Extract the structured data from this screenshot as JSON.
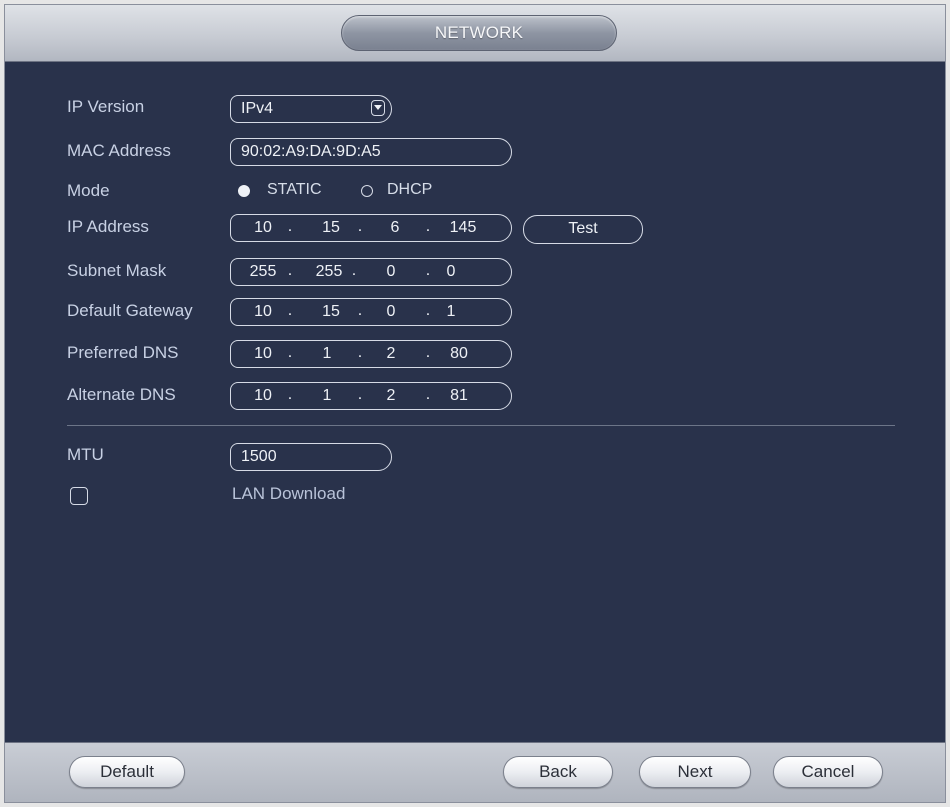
{
  "window": {
    "title": "NETWORK"
  },
  "form": {
    "ip_version": {
      "label": "IP Version",
      "value": "IPv4"
    },
    "mac_address": {
      "label": "MAC Address",
      "value": "90:02:A9:DA:9D:A5"
    },
    "mode": {
      "label": "Mode",
      "options": [
        "STATIC",
        "DHCP"
      ],
      "selected": "STATIC"
    },
    "ip_address": {
      "label": "IP Address",
      "octets": [
        "10",
        "15",
        "6",
        "145"
      ]
    },
    "subnet_mask": {
      "label": "Subnet Mask",
      "octets": [
        "255",
        "255",
        "0",
        "0"
      ]
    },
    "default_gateway": {
      "label": "Default Gateway",
      "octets": [
        "10",
        "15",
        "0",
        "1"
      ]
    },
    "preferred_dns": {
      "label": "Preferred DNS",
      "octets": [
        "10",
        "1",
        "2",
        "80"
      ]
    },
    "alternate_dns": {
      "label": "Alternate DNS",
      "octets": [
        "10",
        "1",
        "2",
        "81"
      ]
    },
    "test_label": "Test",
    "mtu": {
      "label": "MTU",
      "value": "1500"
    },
    "lan_download": {
      "label": "LAN Download",
      "checked": false
    }
  },
  "footer": {
    "default_label": "Default",
    "back_label": "Back",
    "next_label": "Next",
    "cancel_label": "Cancel"
  },
  "icons": {
    "dropdown": "chevron-down-icon",
    "checkbox": "checkbox-icon"
  },
  "colors": {
    "panel": "#29324b",
    "label": "#c8d1e4",
    "field_border": "#d6dbe6"
  }
}
